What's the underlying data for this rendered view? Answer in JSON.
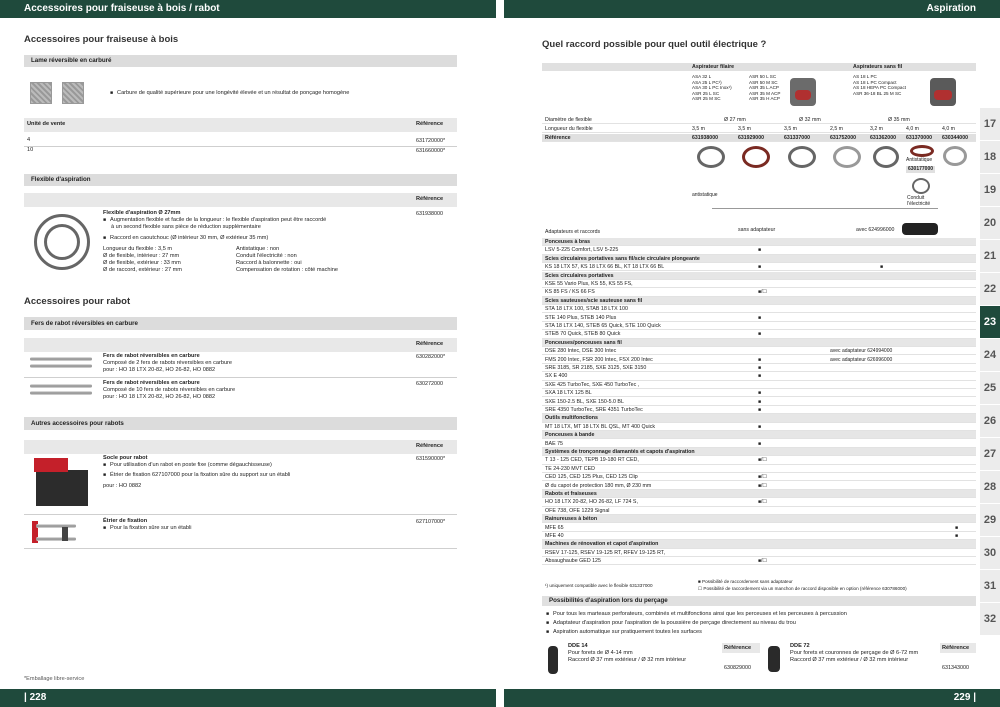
{
  "left": {
    "header": "Accessoires pour fraiseuse à bois / rabot",
    "page_number": "| 228",
    "title_wood": "Accessoires pour fraiseuse à bois",
    "sec_blade": "Lame réversible en carburé",
    "blade_desc": "Carbure de qualité supérieure pour une longévité élevée et un résultat de ponçage homogène",
    "unit_label": "Unité de vente",
    "ref_label": "Référence",
    "blade_rows": [
      {
        "unit": "4",
        "ref": "631720000*"
      },
      {
        "unit": "10",
        "ref": "631660000*"
      }
    ],
    "sec_hose": "Flexible d'aspiration",
    "hose_title": "Flexible d'aspiration Ø 27mm",
    "hose_b1": "Augmentation flexible et facile de la longueur : le flexible d'aspiration peut être raccordé",
    "hose_b1b": "à un second flexible sans pièce de réduction supplémentaire",
    "hose_b2": "Raccord en caoutchouc (Ø intérieur 30 mm, Ø extérieur 35 mm)",
    "hose_specs_left": [
      "Longueur du flexible : 3,5 m",
      "Ø de flexible, intérieur : 27 mm",
      "Ø de flexible, extérieur : 33 mm",
      "Ø de raccord, extérieur : 27 mm"
    ],
    "hose_specs_right": [
      "Antistatique : non",
      "Conduit l'électricité : non",
      "Raccord à baïonnette : oui",
      "Compensation de rotation : côté machine"
    ],
    "hose_ref": "631938000",
    "title_plane": "Accessoires pour rabot",
    "sec_irons": "Fers de rabot réversibles en carbure",
    "iron1_title": "Fers de rabot réversibles en carbure",
    "iron1_l1": "Composé de 2 fers de rabots réversibles en carbure",
    "iron1_l2": "pour : HO 18 LTX 20-82, HO 26-82, HO 0882",
    "iron1_ref": "630282000*",
    "iron2_title": "Fers de rabot réversibles en carbure",
    "iron2_l1": "Composé de 10 fers de rabots réversibles en carbure",
    "iron2_l2": "pour : HO 18 LTX 20-82, HO 26-82, HO 0882",
    "iron2_ref": "630272000",
    "sec_other": "Autres accessoires pour rabots",
    "stand_title": "Socle pour rabot",
    "stand_b1": "Pour utilisation d'un rabot en poste fixe (comme dégauchisseuse)",
    "stand_b2": "Étrier de fixation  627107000 pour la fixation sûre du support sur un établi",
    "stand_for": "pour : HO 0882",
    "stand_ref": "631590000*",
    "clamp_title": "Étrier de fixation",
    "clamp_b1": "Pour la fixation sûre sur un établi",
    "clamp_ref": "627107000*",
    "footnote": "*Emballage libre-service"
  },
  "right": {
    "header": "Aspiration",
    "page_number": "229 |",
    "title": "Quel raccord possible pour quel outil électrique ?",
    "col_filaire": "Aspirateur filaire",
    "col_sansfil": "Aspirateurs sans fil",
    "filaire_models_a": [
      "ASA 32 L",
      "ASA 25 L PC¹)",
      "ASA 30 L PC Inox¹)",
      "ASR 25 L SC",
      "ASR 25 M SC"
    ],
    "filaire_models_b": [
      "ASR 50 L SC",
      "ASR 50 M SC",
      "ASR 35 L ACP",
      "ASR 35 M ACP",
      "ASR 35 H ACP"
    ],
    "sansfil_models": [
      "AS 18 L PC",
      "AS 18 L PC Compact",
      "AS 18 HEPA PC Compact",
      "ASR 36-18 BL 25 M SC"
    ],
    "row_diam_label": "Diamètre de flexible",
    "diam_values": [
      "Ø 27 mm",
      "Ø 32 mm",
      "Ø 35 mm"
    ],
    "row_len_label": "Longueur du flexible",
    "len_values": [
      "3,5 m",
      "3,5 m",
      "3,5 m",
      "2,5 m",
      "3,2 m",
      "4,0 m",
      "4,0 m"
    ],
    "row_ref_label": "Référence",
    "ref_values": [
      "631938000",
      "631929000",
      "631337000",
      "631752000",
      "631362000",
      "631370000",
      "630344000"
    ],
    "antistatique": "antistatique",
    "antistatique2": "Antistatique",
    "extra_ref": "630177000",
    "conduit": "Conduit l'électricité",
    "adapt_label": "Adaptateurs et raccords",
    "sans_adapt": "sans adaptateur",
    "avec_adapt": "avec 624996000",
    "rows": [
      {
        "t": "cat",
        "label": "Ponceuses à bras"
      },
      {
        "label": "LSV 5-225 Comfort, LSV 5-225",
        "m": [
          "",
          "■",
          ""
        ]
      },
      {
        "t": "cat",
        "label": "Scies circulaires portatives sans fil/scie circulaire plongeante"
      },
      {
        "label": "KS 18 LTX 57, KS 18 LTX 66 BL, KT 18 LTX 66 BL",
        "m": [
          "",
          "■",
          "■"
        ]
      },
      {
        "t": "cat",
        "label": "Scies circulaires portatives"
      },
      {
        "label": "KSE 55 Vario Plus, KS 55, KS 55 FS,",
        "m": [
          "",
          "",
          ""
        ]
      },
      {
        "label": "KS 85 FS / KS 66 FS",
        "m": [
          "",
          "■/☐",
          ""
        ]
      },
      {
        "t": "cat",
        "label": "Scies sauteuses/scie sauteuse sans fil"
      },
      {
        "label": "STA 18 LTX 100, STAB 18 LTX 100",
        "m": [
          "",
          "",
          ""
        ]
      },
      {
        "label": "STE 140 Plus, STEB 140 Plus",
        "m": [
          "",
          "■",
          ""
        ]
      },
      {
        "label": "STA 18 LTX 140, STEB 65 Quick, STE 100 Quick",
        "m": [
          "",
          "",
          ""
        ]
      },
      {
        "label": "STEB 70 Quick, STEB 80 Quick",
        "m": [
          "",
          "■",
          ""
        ]
      },
      {
        "t": "cat",
        "label": "Ponceuses/ponceuses sans fil"
      },
      {
        "label": "DSE 280 Intec, DSE 300 Intec",
        "m": [
          "",
          "",
          "avec adaptateur 624994000"
        ]
      },
      {
        "label": "FMS 200 Intec, FSR 200 Intec, FSX 200 Intec",
        "m": [
          "",
          "■",
          "avec adaptateur 626996000"
        ]
      },
      {
        "label": "SRE 3185, SR 2185, SXE 3125, SXE 3150",
        "m": [
          "",
          "■",
          ""
        ]
      },
      {
        "label": "SX E 400",
        "m": [
          "",
          "■",
          ""
        ]
      },
      {
        "label": "SXE 425 TurboTec, SXE 450 TurboTec ,",
        "m": [
          "",
          "",
          ""
        ]
      },
      {
        "label": "SXA 18 LTX 125 BL",
        "m": [
          "",
          "■",
          ""
        ]
      },
      {
        "label": "SXE 150-2.5 BL, SXE 150-5.0 BL",
        "m": [
          "",
          "■",
          ""
        ]
      },
      {
        "label": "SRE 4350 TurboTec, SRE 4351 TurboTec",
        "m": [
          "",
          "■",
          ""
        ]
      },
      {
        "t": "cat",
        "label": "Outils multifonctions"
      },
      {
        "label": "MT 18 LTX, MT 18 LTX BL QSL, MT 400 Quick",
        "m": [
          "",
          "■",
          ""
        ]
      },
      {
        "t": "cat",
        "label": "Ponceuses à bande"
      },
      {
        "label": "BAE 75",
        "m": [
          "",
          "■",
          ""
        ]
      },
      {
        "t": "cat",
        "label": "Systèmes de tronçonnage diamantés et capots d'aspiration"
      },
      {
        "label": "T 13 - 125 CED, TEPB 19-180 RT CED,",
        "m": [
          "",
          "■/☐",
          ""
        ]
      },
      {
        "label": "TE 24-230 MVT CED",
        "m": [
          "",
          "",
          ""
        ]
      },
      {
        "label": "CED 125, CED 125 Plus, CED 125 Clip",
        "m": [
          "",
          "■/☐",
          ""
        ]
      },
      {
        "label": "Ø du capot de protection 180 mm, Ø 230 mm",
        "m": [
          "",
          "■/☐",
          ""
        ]
      },
      {
        "t": "cat",
        "label": "Rabots et fraiseuses"
      },
      {
        "label": "HO 18 LTX 20-82, HO 26-82, LF 724 S,",
        "m": [
          "",
          "■/☐",
          ""
        ]
      },
      {
        "label": "OFE 738, OFE 1229 Signal",
        "m": [
          "",
          "",
          ""
        ]
      },
      {
        "t": "cat",
        "label": "Rainureuses à béton"
      },
      {
        "label": "MFE 65",
        "m": [
          "",
          "",
          "■"
        ]
      },
      {
        "label": "MFE 40",
        "m": [
          "",
          "",
          "■"
        ]
      },
      {
        "t": "cat",
        "label": "Machines de rénovation et capot d'aspiration"
      },
      {
        "label": "RSEV 17-125, RSEV 19-125 RT, RFEV 19-125 RT,",
        "m": [
          "",
          "",
          ""
        ]
      },
      {
        "label": "Absaughaube GED 125",
        "m": [
          "",
          "■/☐",
          ""
        ]
      }
    ],
    "foot1": "¹) uniquement compatible avec le flexible 631337000",
    "foot2": "■ Possibilité de raccordement sans adaptateur",
    "foot3": "☐ Possibilité de raccordement via un manchon de raccord disponible en option (référence 630786000)",
    "drill_title": "Possibilités d'aspiration lors du perçage",
    "drill_b1": "Pour tous les marteaux perforateurs, combinés et multifonctions ainsi que les perceuses et les perceuses à percussion",
    "drill_b2": "Adaptateur d'aspiration pour l'aspiration de la poussière de perçage directement au niveau du trou",
    "drill_b3": "Aspiration automatique sur pratiquement toutes les surfaces",
    "dde14_title": "DDE 14",
    "dde14_l1": "Pour forets de Ø 4-14 mm",
    "dde14_l2": "Raccord Ø 37 mm extérieur / Ø 32 mm intérieur",
    "dde14_ref": "630829000",
    "dde72_title": "DDE 72",
    "dde72_l1": "Pour forets et couronnes de perçage de Ø 6-72 mm",
    "dde72_l2": "Raccord Ø 37 mm extérieur / Ø 32 mm intérieur",
    "dde72_ref": "631343000",
    "ref_label": "Référence"
  },
  "tabs": [
    "17",
    "18",
    "19",
    "20",
    "21",
    "22",
    "23",
    "24",
    "25",
    "26",
    "27",
    "28",
    "29",
    "30",
    "31",
    "32"
  ],
  "active_tab": "23",
  "colors": {
    "brand": "#1f4a3c",
    "accent_red": "#c4202a"
  }
}
